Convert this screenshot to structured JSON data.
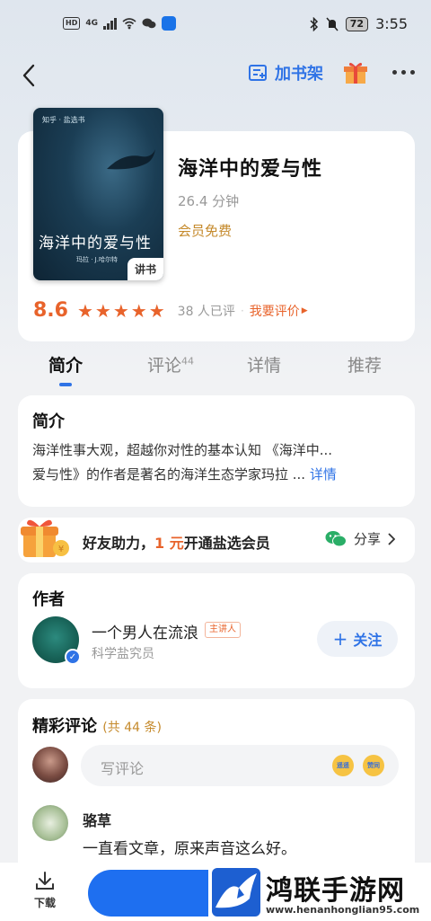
{
  "status_bar": {
    "hd": "HD",
    "network": "4G",
    "battery": "72",
    "time": "3:55"
  },
  "nav": {
    "add_shelf_label": "加书架",
    "icons": [
      "chevron-left-icon",
      "bookshelf-icon",
      "gift-icon",
      "more-icon"
    ]
  },
  "book": {
    "title": "海洋中的爱与性",
    "duration": "26.4 分钟",
    "vip_label": "会员免费",
    "cover": {
      "brand": "知乎 · 盐选书",
      "title": "海洋中的爱与性",
      "subtitle": "玛拉 · J.哈尔特",
      "tag": "讲书"
    },
    "score": "8.6",
    "stars": 5,
    "rated_count": "38 人已评",
    "rate_link": "我要评价"
  },
  "tabs": {
    "intro": "简介",
    "comments": "评论",
    "comments_count": "44",
    "details": "详情",
    "recommend": "推荐"
  },
  "intro": {
    "title": "简介",
    "line1": "海洋性事大观，超越你对性的基本认知 《海洋中...",
    "line2": "爱与性》的作者是著名的海洋生态学家玛拉 ...",
    "more_link": "详情"
  },
  "promo": {
    "text_a": "好友助力，",
    "text_em": "1 元",
    "text_b": "开通盐选会员",
    "share_label": "分享"
  },
  "author": {
    "section_title": "作者",
    "name": "一个男人在流浪",
    "badge": "主讲人",
    "role": "科学盐究员",
    "follow_label": "关注"
  },
  "comments": {
    "section_title": "精彩评论",
    "count_label": "(共 44 条)",
    "placeholder": "写评论",
    "emoji_a": "遥遥",
    "emoji_b": "赞同",
    "items": [
      {
        "user": "骆草",
        "text": "一直看文章，原来声音这么好。"
      }
    ]
  },
  "bottom": {
    "download_label": "下载"
  },
  "watermark": {
    "title": "鸿联手游网",
    "url": "www.henanhonglian95.com"
  },
  "colors": {
    "accent_blue": "#2f73e6",
    "accent_orange": "#e8632b",
    "vip_gold": "#c58a2c"
  }
}
